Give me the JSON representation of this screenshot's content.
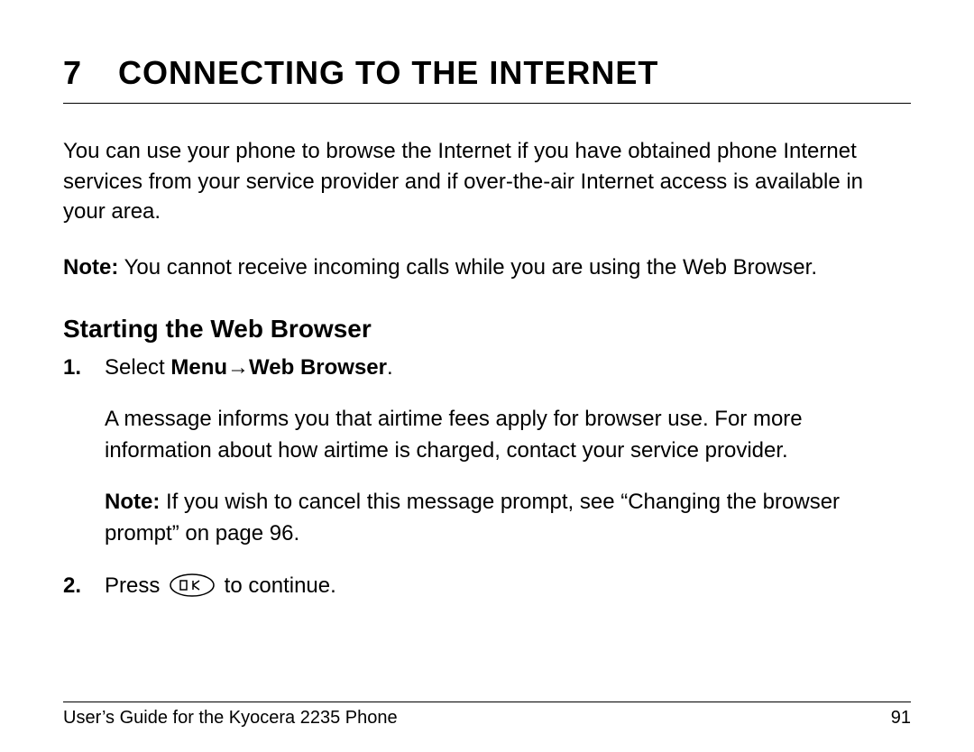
{
  "chapter": {
    "number": "7",
    "title": "Connecting to the Internet"
  },
  "intro": "You can use your phone to browse the Internet if you have obtained phone Internet services from your service provider and if over-the-air Internet access is available in your area.",
  "note1": {
    "label": "Note:",
    "text": " You cannot receive incoming calls while you are using the Web Browser."
  },
  "section": {
    "heading": "Starting the Web Browser"
  },
  "steps": [
    {
      "num": "1.",
      "lead_text": "Select ",
      "menu_word": "Menu",
      "arrow": " → ",
      "menu_target": "Web Browser",
      "period": ".",
      "para2": "A message informs you that airtime fees apply for browser use. For more information about how airtime is charged, contact your service provider.",
      "note_label": "Note:",
      "note_text": " If you wish to cancel this message prompt, see “Changing the browser prompt” on page 96."
    },
    {
      "num": "2.",
      "press_text": "Press ",
      "continue_text": " to continue.",
      "ok_label": "OK"
    }
  ],
  "footer": {
    "left": "User’s Guide for the Kyocera 2235 Phone",
    "right": "91"
  }
}
